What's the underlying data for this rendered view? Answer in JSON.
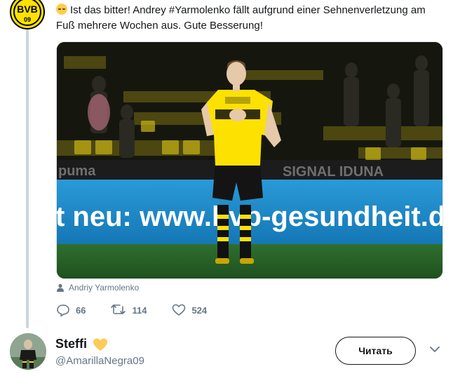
{
  "tweet": {
    "text_before_hashtag": "Ist das bitter! Andrey ",
    "hashtag": "#Yarmolenko",
    "text_after_hashtag": " fällt aufgrund einer Sehnenverletzung am Fuß mehrere Wochen aus. Gute Besserung!",
    "emoji": "pensive-face",
    "avatar_logo_text": "BVB",
    "avatar_logo_year": "09",
    "media": {
      "ad_board_text": "t neu: www.bvb-gesundheit.d",
      "sponsor_left": "puma",
      "sponsor_right": "SIGNAL IDUNA"
    },
    "tagged_person": "Andriy Yarmolenko",
    "actions": {
      "replies": "66",
      "retweets": "114",
      "likes": "524"
    }
  },
  "next_user": {
    "name": "Steffi",
    "handle": "@AmarillaNegra09",
    "badge_emoji": "yellow-heart",
    "follow_label": "Читать"
  },
  "colors": {
    "bvb_yellow": "#fde100",
    "text_primary": "#14171a",
    "text_secondary": "#657786",
    "thread_line": "#ccd6dd",
    "board_blue": "#1a8fd0"
  }
}
